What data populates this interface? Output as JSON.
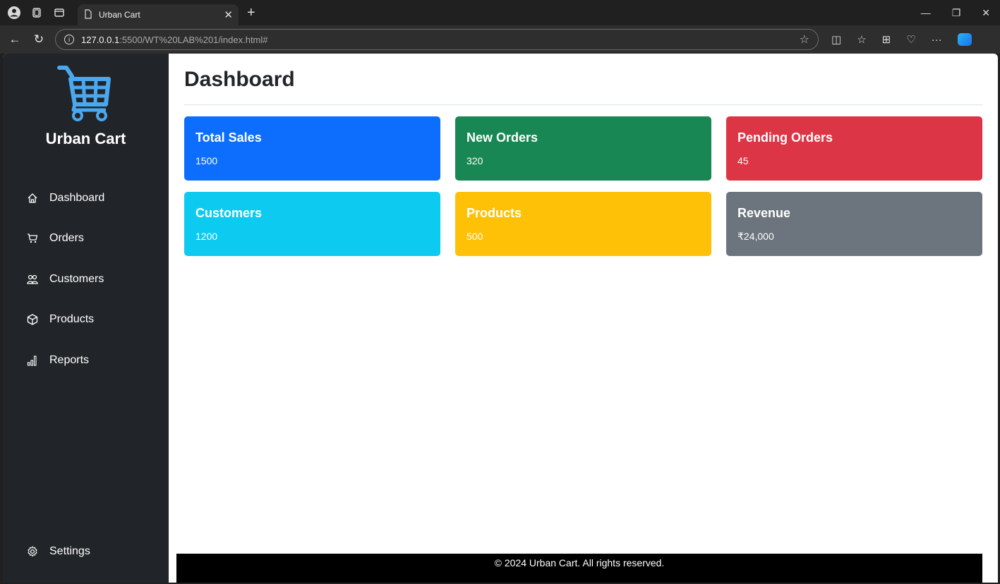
{
  "browser": {
    "tab_title": "Urban Cart",
    "new_tab": "+",
    "url_host": "127.0.0.1",
    "url_rest": ":5500/WT%20LAB%201/index.html#"
  },
  "sidebar": {
    "brand": "Urban Cart",
    "items": [
      {
        "label": "Dashboard",
        "icon": "home-icon"
      },
      {
        "label": "Orders",
        "icon": "cart-icon"
      },
      {
        "label": "Customers",
        "icon": "people-icon"
      },
      {
        "label": "Products",
        "icon": "box-icon"
      },
      {
        "label": "Reports",
        "icon": "bar-chart-icon"
      }
    ],
    "settings": {
      "label": "Settings",
      "icon": "gear-icon"
    }
  },
  "main": {
    "title": "Dashboard",
    "cards": [
      {
        "title": "Total Sales",
        "value": "1500",
        "color": "#0d6efd"
      },
      {
        "title": "New Orders",
        "value": "320",
        "color": "#198754"
      },
      {
        "title": "Pending Orders",
        "value": "45",
        "color": "#dc3545"
      },
      {
        "title": "Customers",
        "value": "1200",
        "color": "#0dcaf0"
      },
      {
        "title": "Products",
        "value": "500",
        "color": "#ffc107"
      },
      {
        "title": "Revenue",
        "value": "₹24,000",
        "color": "#6c757d"
      }
    ]
  },
  "footer": {
    "text": "© 2024 Urban Cart. All rights reserved."
  }
}
